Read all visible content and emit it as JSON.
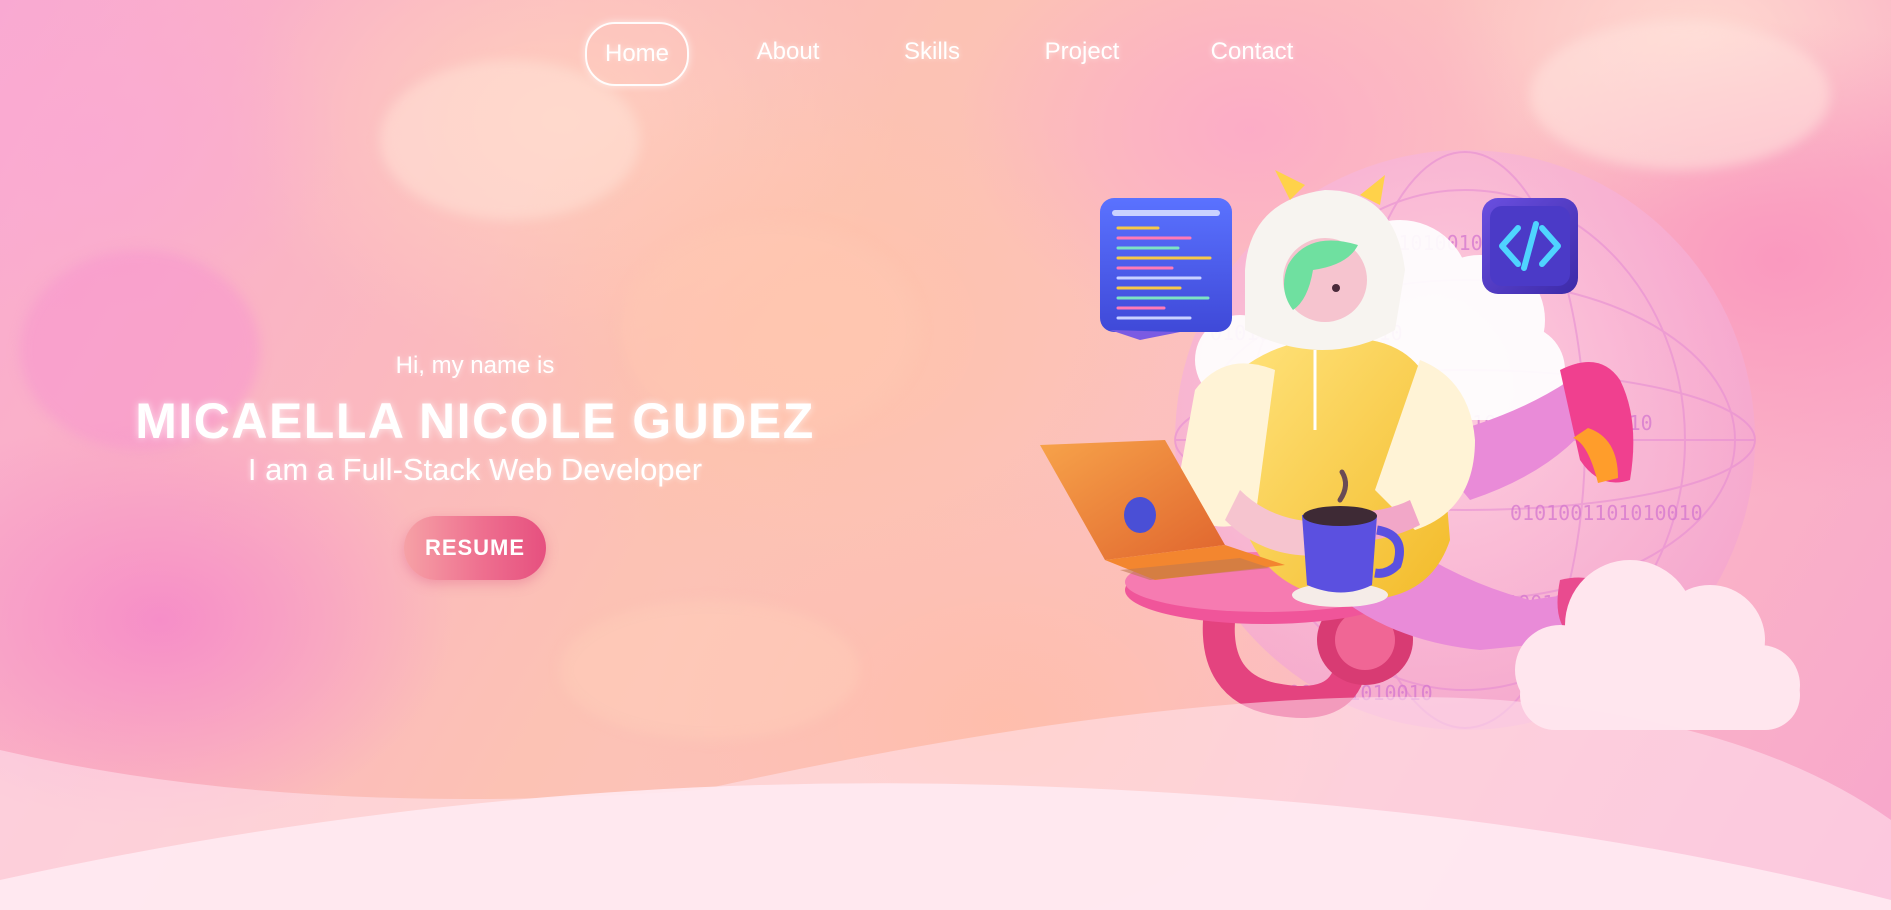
{
  "nav": {
    "items": [
      {
        "label": "Home",
        "active": true
      },
      {
        "label": "About",
        "active": false
      },
      {
        "label": "Skills",
        "active": false
      },
      {
        "label": "Project",
        "active": false
      },
      {
        "label": "Contact",
        "active": false
      }
    ]
  },
  "hero": {
    "greeting": "Hi, my name is",
    "name": "MICAELLA NICOLE GUDEZ",
    "role": "I am a Full-Stack Web Developer",
    "resume_label": "RESUME"
  },
  "illustration": {
    "icons": [
      "code-editor-icon",
      "code-brackets-icon"
    ],
    "globe_text": "0101001101010010"
  },
  "colors": {
    "accent": "#e6507f",
    "button_start": "#f6a1a6",
    "background_pink": "#f9a9d2",
    "background_peach": "#fcc2b4"
  }
}
